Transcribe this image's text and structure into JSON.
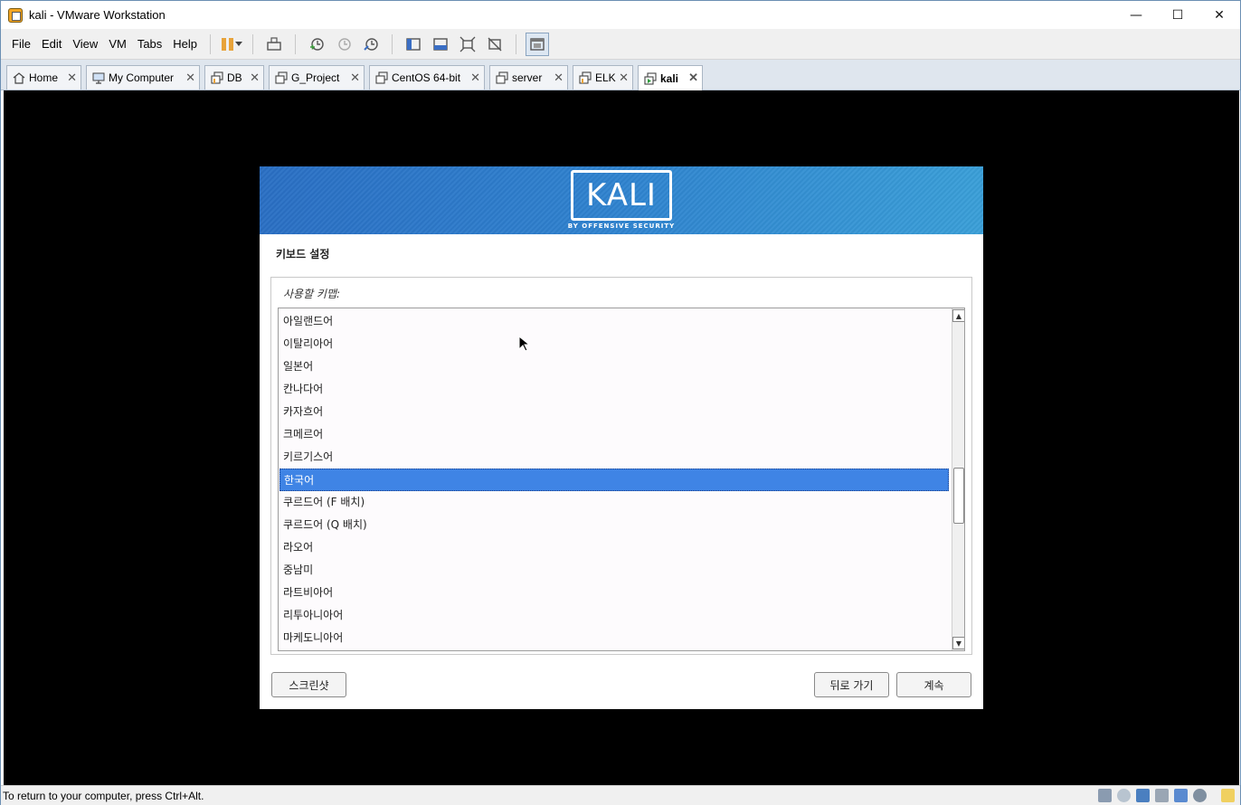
{
  "window": {
    "title": "kali - VMware Workstation",
    "controls": {
      "minimize": "—",
      "maximize": "☐",
      "close": "✕"
    }
  },
  "menu": {
    "items": [
      "File",
      "Edit",
      "View",
      "VM",
      "Tabs",
      "Help"
    ]
  },
  "tabs": [
    {
      "label": "Home",
      "close": "✕",
      "icon": "home-icon"
    },
    {
      "label": "My Computer",
      "close": "✕",
      "icon": "computer-icon"
    },
    {
      "label": "DB",
      "close": "✕",
      "icon": "vm-icon"
    },
    {
      "label": "G_Project",
      "close": "✕",
      "icon": "vm-icon"
    },
    {
      "label": "CentOS 64-bit",
      "close": "✕",
      "icon": "vm-icon"
    },
    {
      "label": "server",
      "close": "✕",
      "icon": "vm-icon"
    },
    {
      "label": "ELK",
      "close": "✕",
      "icon": "vm-icon"
    },
    {
      "label": "kali",
      "close": "✕",
      "icon": "vm-running-icon"
    }
  ],
  "installer": {
    "logo_text": "KALI",
    "logo_sub": "BY OFFENSIVE SECURITY",
    "page_title": "키보드 설정",
    "list_label": "사용할 키맵:",
    "items": [
      "아일랜드어",
      "이탈리아어",
      "일본어",
      "칸나다어",
      "카자흐어",
      "크메르어",
      "키르기스어",
      "한국어",
      "쿠르드어 (F 배치)",
      "쿠르드어 (Q 배치)",
      "라오어",
      "중남미",
      "라트비아어",
      "리투아니아어",
      "마케도니아어"
    ],
    "selected": "한국어",
    "buttons": {
      "screenshot": "스크린샷",
      "back": "뒤로 가기",
      "continue": "계속"
    }
  },
  "status": {
    "text": "To return to your computer, press Ctrl+Alt."
  },
  "colors": {
    "selection": "#3f84e5",
    "banner": "#2f83cf",
    "vm_background": "#000000"
  }
}
